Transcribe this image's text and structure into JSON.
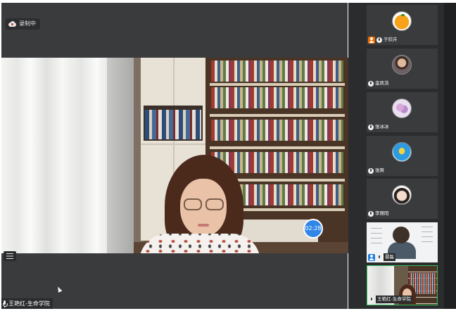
{
  "meeting": {
    "recording_label": "录制中",
    "timer": "02:28",
    "active_speaker": "王艳红-生命学院"
  },
  "participants": [
    {
      "name": "于欣卉",
      "role": "host",
      "avatar": "orange-fruit"
    },
    {
      "name": "金凤浩",
      "role": "",
      "avatar": "person-photo"
    },
    {
      "name": "张冰冰",
      "role": "",
      "avatar": "flower-photo"
    },
    {
      "name": "张爽",
      "role": "",
      "avatar": "blue-cartoon"
    },
    {
      "name": "李丽阳",
      "role": "",
      "avatar": "cartoon-girl"
    },
    {
      "name": "晏磊",
      "role": "cohost",
      "avatar": "video"
    },
    {
      "name": "王艳红-生命学院",
      "role": "",
      "avatar": "video"
    }
  ],
  "colors": {
    "stage_bg": "#3a3b3d",
    "timer_blue": "#2f86e6",
    "host_orange": "#ef6c00",
    "cohost_blue": "#1e7be0",
    "active_green": "#2fbf5b"
  },
  "icons": {
    "recording": "cloud-recording-icon",
    "layout": "list-icon",
    "mic": "mic-icon",
    "cursor": "cursor-icon"
  }
}
